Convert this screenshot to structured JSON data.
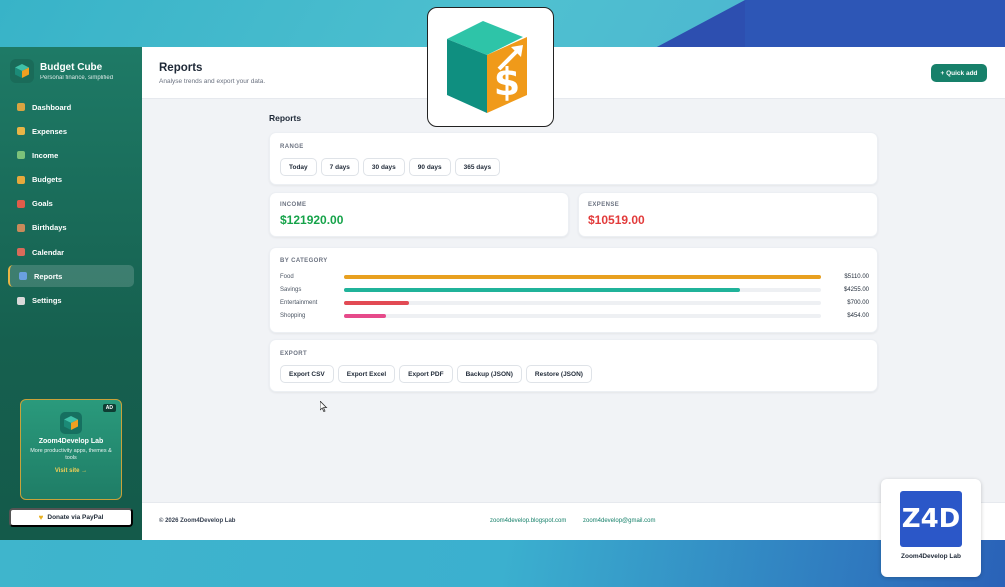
{
  "brand": {
    "title": "Budget Cube",
    "subtitle": "Personal finance, simplified"
  },
  "nav": [
    {
      "label": "Dashboard",
      "icon": "dashboard-icon",
      "color": "#d9a441"
    },
    {
      "label": "Expenses",
      "icon": "expenses-icon",
      "color": "#e8b546"
    },
    {
      "label": "Income",
      "icon": "income-icon",
      "color": "#7cc27a"
    },
    {
      "label": "Budgets",
      "icon": "budgets-icon",
      "color": "#e6a93c"
    },
    {
      "label": "Goals",
      "icon": "goals-icon",
      "color": "#e05c4a"
    },
    {
      "label": "Birthdays",
      "icon": "birthdays-icon",
      "color": "#c98a5a"
    },
    {
      "label": "Calendar",
      "icon": "calendar-icon",
      "color": "#d96b5a"
    },
    {
      "label": "Reports",
      "icon": "reports-icon",
      "color": "#6aa0e0",
      "active": true
    },
    {
      "label": "Settings",
      "icon": "settings-icon",
      "color": "#d9d9d9"
    }
  ],
  "ad": {
    "badge": "AD",
    "title": "Zoom4Develop Lab",
    "desc": "More productivity apps, themes & tools",
    "link": "Visit site →"
  },
  "paypal": {
    "label": "Donate via PayPal"
  },
  "header": {
    "title": "Reports",
    "subtitle": "Analyse trends and export your data.",
    "quick_add": "+ Quick add"
  },
  "section_title": "Reports",
  "range": {
    "label": "RANGE",
    "options": [
      "Today",
      "7 days",
      "30 days",
      "90 days",
      "365 days"
    ]
  },
  "income": {
    "label": "INCOME",
    "amount": "$121920.00"
  },
  "expense": {
    "label": "EXPENSE",
    "amount": "$10519.00"
  },
  "by_category": {
    "label": "BY CATEGORY",
    "items": [
      {
        "name": "Food",
        "value": "$5110.00",
        "fraction": 1.0,
        "color": "#e8a020"
      },
      {
        "name": "Savings",
        "value": "$4255.00",
        "fraction": 0.83,
        "color": "#20b39a"
      },
      {
        "name": "Entertainment",
        "value": "$700.00",
        "fraction": 0.137,
        "color": "#e24a54"
      },
      {
        "name": "Shopping",
        "value": "$454.00",
        "fraction": 0.089,
        "color": "#e64a8a"
      }
    ]
  },
  "export": {
    "label": "EXPORT",
    "buttons": [
      "Export CSV",
      "Export Excel",
      "Export PDF",
      "Backup (JSON)",
      "Restore (JSON)"
    ]
  },
  "footer": {
    "copyright": "© 2026 Zoom4Develop Lab",
    "blog": "zoom4develop.blogspot.com",
    "email": "zoom4develop@gmail.com"
  },
  "watermark": {
    "text": "Zoom4Develop Lab",
    "mark": "Z4D"
  }
}
